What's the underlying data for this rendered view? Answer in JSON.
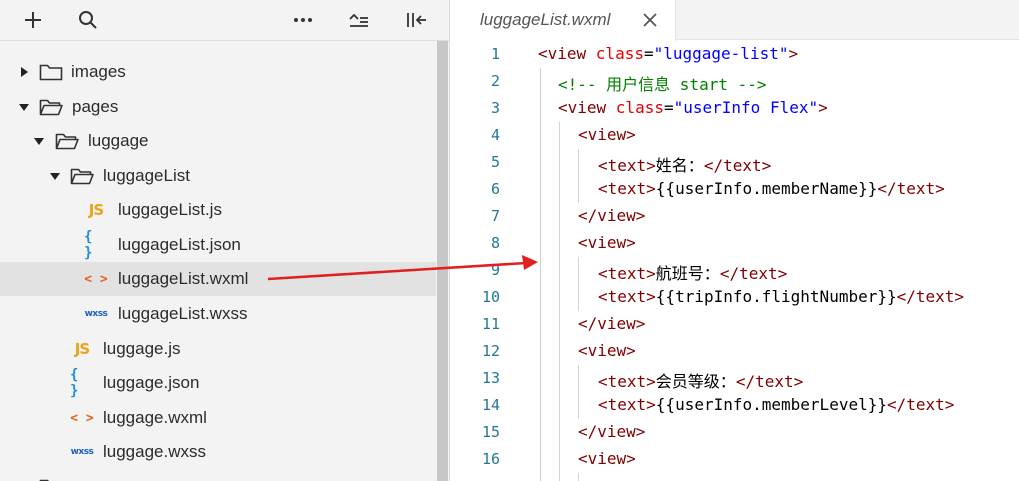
{
  "toolbar": {
    "buttons": [
      {
        "name": "add-icon"
      },
      {
        "name": "search-icon"
      },
      {
        "name": "more-icon"
      },
      {
        "name": "collapse-all-icon"
      },
      {
        "name": "toggle-sidebar-icon"
      }
    ]
  },
  "tree": {
    "items": [
      {
        "label": "images",
        "kind": "folder",
        "expanded": false
      },
      {
        "label": "pages",
        "kind": "folder",
        "expanded": true
      },
      {
        "label": "luggage",
        "kind": "folder",
        "expanded": true
      },
      {
        "label": "luggageList",
        "kind": "folder",
        "expanded": true
      },
      {
        "label": "luggageList.js",
        "kind": "js",
        "badge": "JS"
      },
      {
        "label": "luggageList.json",
        "kind": "json",
        "badge": "{ }"
      },
      {
        "label": "luggageList.wxml",
        "kind": "wxml",
        "badge": "< >",
        "selected": true
      },
      {
        "label": "luggageList.wxss",
        "kind": "wxss",
        "badge": "wxss"
      },
      {
        "label": "luggage.js",
        "kind": "js",
        "badge": "JS"
      },
      {
        "label": "luggage.json",
        "kind": "json",
        "badge": "{ }"
      },
      {
        "label": "luggage.wxml",
        "kind": "wxml",
        "badge": "< >"
      },
      {
        "label": "luggage.wxss",
        "kind": "wxss",
        "badge": "wxss"
      }
    ]
  },
  "editor": {
    "tab_title": "luggageList.wxml",
    "line_numbers": [
      "1",
      "2",
      "3",
      "4",
      "5",
      "6",
      "7",
      "8",
      "9",
      "10",
      "11",
      "12",
      "13",
      "14",
      "15",
      "16"
    ],
    "lines": [
      [
        {
          "t": "tag",
          "v": "<view "
        },
        {
          "t": "attr",
          "v": "class"
        },
        {
          "t": "txt",
          "v": "="
        },
        {
          "t": "str",
          "v": "\"luggage-list\""
        },
        {
          "t": "tag",
          "v": ">"
        }
      ],
      [
        {
          "t": "cmt",
          "v": "<!-- 用户信息 start -->"
        }
      ],
      [
        {
          "t": "tag",
          "v": "<view "
        },
        {
          "t": "attr",
          "v": "class"
        },
        {
          "t": "txt",
          "v": "="
        },
        {
          "t": "str",
          "v": "\"userInfo Flex\""
        },
        {
          "t": "tag",
          "v": ">"
        }
      ],
      [
        {
          "t": "tag",
          "v": "<view>"
        }
      ],
      [
        {
          "t": "tag",
          "v": "<text>"
        },
        {
          "t": "txt",
          "v": "姓名："
        },
        {
          "t": "tag",
          "v": "</text>"
        }
      ],
      [
        {
          "t": "tag",
          "v": "<text>"
        },
        {
          "t": "txt",
          "v": "{{userInfo.memberName}}"
        },
        {
          "t": "tag",
          "v": "</text>"
        }
      ],
      [
        {
          "t": "tag",
          "v": "</view>"
        }
      ],
      [
        {
          "t": "tag",
          "v": "<view>"
        }
      ],
      [
        {
          "t": "tag",
          "v": "<text>"
        },
        {
          "t": "txt",
          "v": "航班号："
        },
        {
          "t": "tag",
          "v": "</text>"
        }
      ],
      [
        {
          "t": "tag",
          "v": "<text>"
        },
        {
          "t": "txt",
          "v": "{{tripInfo.flightNumber}}"
        },
        {
          "t": "tag",
          "v": "</text>"
        }
      ],
      [
        {
          "t": "tag",
          "v": "</view>"
        }
      ],
      [
        {
          "t": "tag",
          "v": "<view>"
        }
      ],
      [
        {
          "t": "tag",
          "v": "<text>"
        },
        {
          "t": "txt",
          "v": "会员等级："
        },
        {
          "t": "tag",
          "v": "</text>"
        }
      ],
      [
        {
          "t": "tag",
          "v": "<text>"
        },
        {
          "t": "txt",
          "v": "{{userInfo.memberLevel}}"
        },
        {
          "t": "tag",
          "v": "</text>"
        }
      ],
      [
        {
          "t": "tag",
          "v": "</view>"
        }
      ],
      [
        {
          "t": "tag",
          "v": "<view>"
        }
      ]
    ]
  },
  "colors": {
    "tag": "#800000",
    "attr": "#e50000",
    "string": "#0000ff",
    "comment": "#008000",
    "line_number": "#237893",
    "arrow": "#e02020",
    "selected_row": "#e2e2e2"
  }
}
